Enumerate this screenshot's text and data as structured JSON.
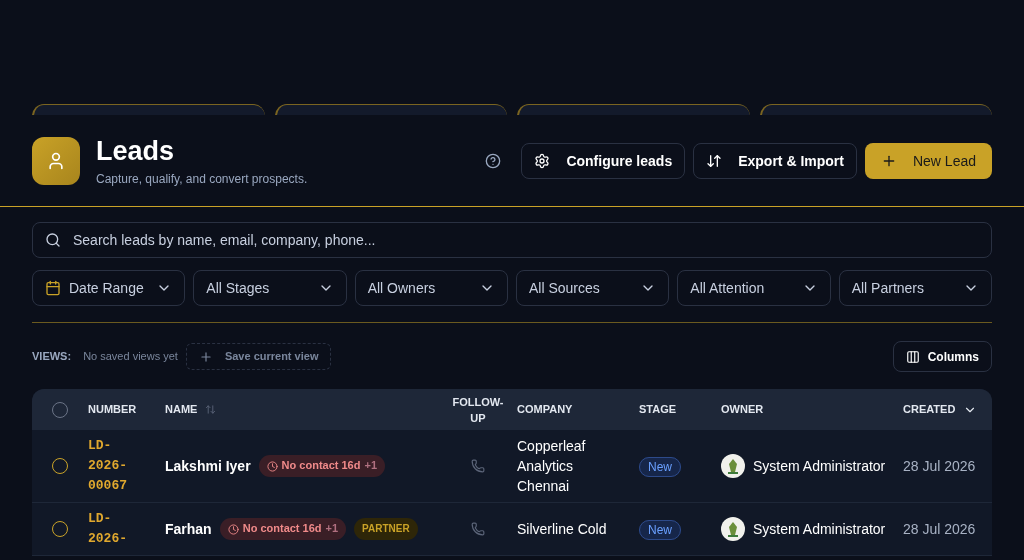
{
  "stat_cards": [
    {
      "kind": "card"
    },
    {
      "kind": "card"
    },
    {
      "kind": "card"
    },
    {
      "kind": "card"
    }
  ],
  "header": {
    "title": "Leads",
    "subtitle": "Capture, qualify, and convert prospects.",
    "buttons": [
      {
        "label": "Configure leads",
        "kind": "settings"
      },
      {
        "label": "Export & Import",
        "kind": "transfer"
      },
      {
        "label": "New Lead",
        "kind": "primary"
      }
    ]
  },
  "search": {
    "placeholder": "Search leads by name, email, company, phone..."
  },
  "filters": [
    {
      "label": "Date Range",
      "kind": "date"
    },
    {
      "label": "All Stages",
      "kind": "select"
    },
    {
      "label": "All Owners",
      "kind": "select"
    },
    {
      "label": "All Sources",
      "kind": "select"
    },
    {
      "label": "All Attention",
      "kind": "select"
    },
    {
      "label": "All Partners",
      "kind": "select"
    }
  ],
  "views": {
    "label": "VIEWS:",
    "empty": "No saved views yet",
    "save": "Save current view",
    "columns": "Columns"
  },
  "table": {
    "select_all_checked": false,
    "columns": [
      {
        "label": "NUMBER",
        "kind": "plain"
      },
      {
        "label": "NAME",
        "kind": "sortable"
      },
      {
        "label": "FOLLOW-UP",
        "kind": "plain"
      },
      {
        "label": "COMPANY",
        "kind": "plain"
      },
      {
        "label": "STAGE",
        "kind": "plain"
      },
      {
        "label": "OWNER",
        "kind": "plain"
      },
      {
        "label": "CREATED",
        "kind": "sorted"
      }
    ],
    "rows": [
      {
        "checked": false,
        "number": "LD-2026-00067",
        "name": "Lakshmi Iyer",
        "alert": "No contact 16d",
        "alert_more": "+1",
        "tags": [],
        "company": "Copperleaf Analytics Chennai",
        "stage": "New",
        "owner": "System Administrator",
        "created": "28 Jul 2026"
      },
      {
        "checked": false,
        "number": "LD-2026-",
        "name": "Farhan",
        "alert": "No contact 16d",
        "alert_more": "+1",
        "tags": [
          "PARTNER"
        ],
        "company": "Silverline Cold",
        "stage": "New",
        "owner": "System Administrator",
        "created": "28 Jul 2026"
      }
    ]
  }
}
